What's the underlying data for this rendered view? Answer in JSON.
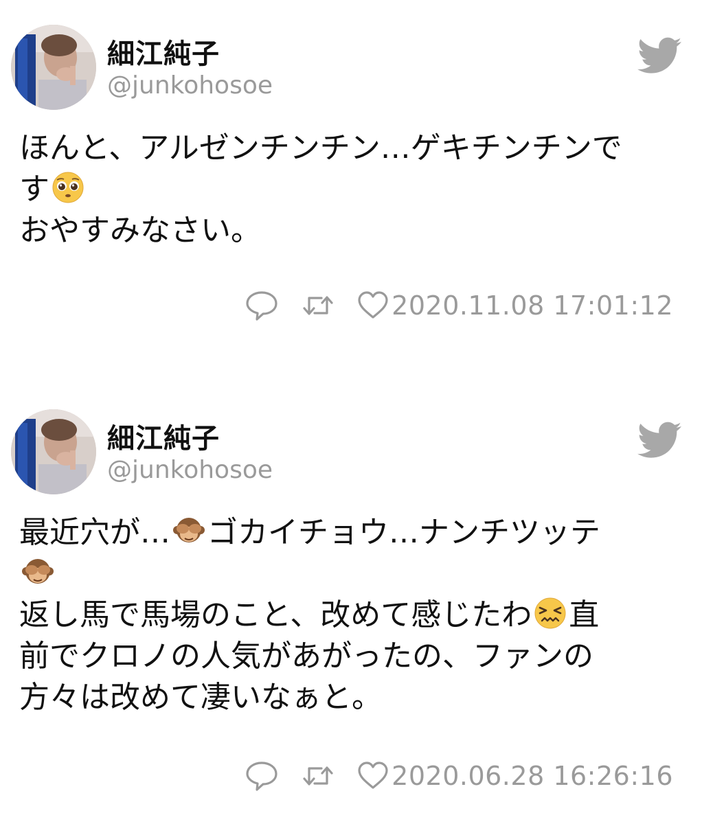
{
  "tweets": [
    {
      "display_name": "細江純子",
      "handle": "@junkohosoe",
      "lines": [
        {
          "text": "ほんと、アルゼンチンチン…ゲキチンチンで"
        },
        {
          "text": "す",
          "emoji_after": "pleading-face-emoji"
        },
        {
          "text": "おやすみなさい。"
        }
      ],
      "timestamp": "2020.11.08 17:01:12"
    },
    {
      "display_name": "細江純子",
      "handle": "@junkohosoe",
      "lines": [
        {
          "pre": "最近穴が…",
          "emoji": "see-no-evil-monkey-emoji",
          "post": "ゴカイチョウ…ナンチツッテ"
        },
        {
          "emoji_only": "see-no-evil-monkey-emoji"
        },
        {
          "pre": "返し馬で馬場のこと、改めて感じたわ",
          "emoji": "confounded-face-emoji",
          "post": "直"
        },
        {
          "text": "前でクロノの人気があがったの、ファンの"
        },
        {
          "text": "方々は改めて凄いなぁと。"
        }
      ],
      "timestamp": "2020.06.28 16:26:16"
    }
  ],
  "icons": {
    "reply": "speech-bubble-icon",
    "retweet": "retweet-icon",
    "like": "heart-icon",
    "brand": "twitter-bird-icon"
  },
  "colors": {
    "text": "#111111",
    "muted": "#9a9a9a",
    "icon": "#9a9a9a",
    "background": "#ffffff"
  }
}
